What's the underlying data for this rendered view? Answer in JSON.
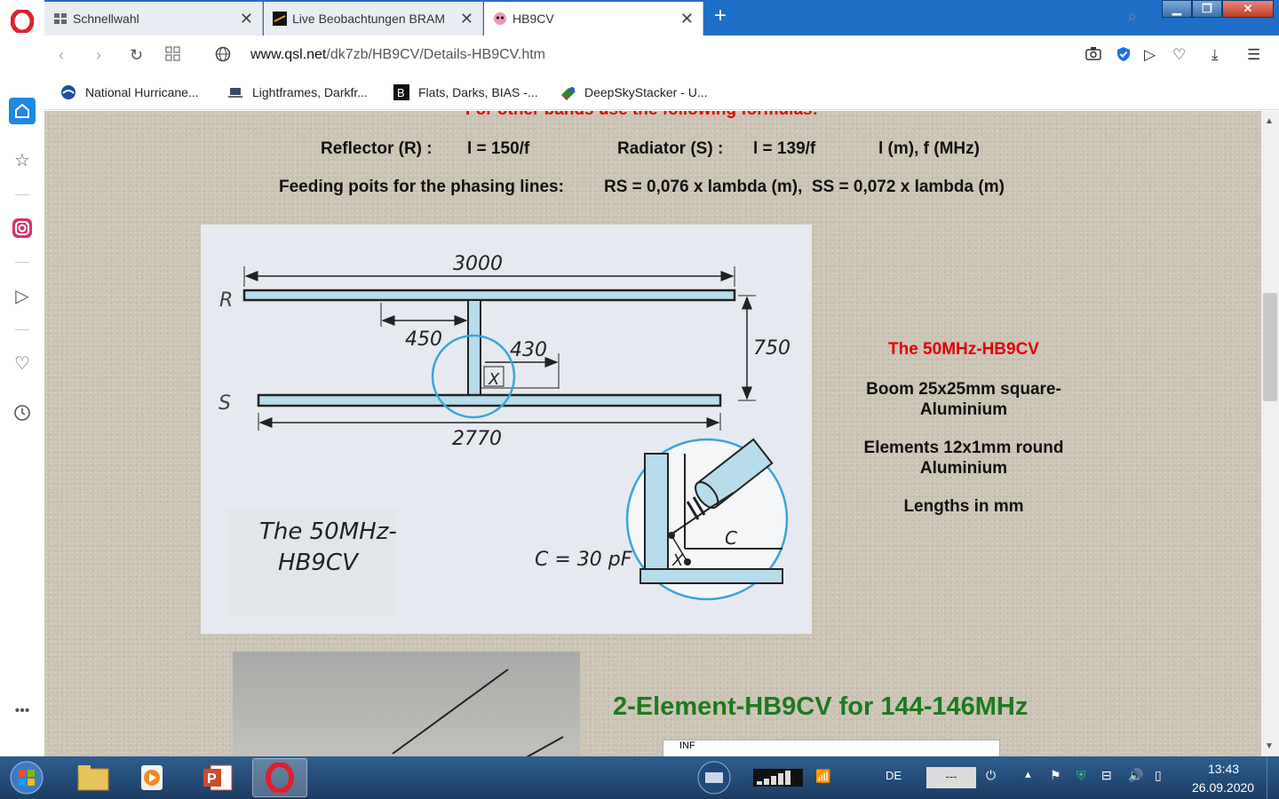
{
  "tabs": [
    {
      "label": "Schnellwahl"
    },
    {
      "label": "Live Beobachtungen BRAM"
    },
    {
      "label": "HB9CV"
    }
  ],
  "address": {
    "host": "www.qsl.net",
    "path": "/dk7zb/HB9CV/Details-HB9CV.htm"
  },
  "bookmarks": [
    {
      "label": "National Hurricane..."
    },
    {
      "label": "Lightframes, Darkfr..."
    },
    {
      "label": "Flats, Darks, BIAS -..."
    },
    {
      "label": "DeepSkyStacker - U..."
    }
  ],
  "page": {
    "formula_heading_cut": "For other bands use the following formulas:",
    "reflector_label": "Reflector (R) :",
    "reflector_formula": "l = 150/f",
    "radiator_label": "Radiator (S) :",
    "radiator_formula": "l = 139/f",
    "units": "l (m), f (MHz)",
    "feeding_label": "Feeding poits for the phasing lines:",
    "feeding_formula": "RS = 0,076 x lambda (m),  SS = 0,072 x lambda (m)",
    "diagram": {
      "reflector_letter": "R",
      "radiator_letter": "S",
      "dim_reflector": "3000",
      "dim_radiator": "2770",
      "dim_spacing": "750",
      "dim_450": "450",
      "dim_430": "430",
      "x_label": "X",
      "c_label": "C",
      "caption_line1": "The 50MHz-",
      "caption_line2": "HB9CV",
      "capacitor": "C = 30 pF"
    },
    "info_title": "The 50MHz-HB9CV",
    "info_boom": "Boom 25x25mm square-\nAluminium",
    "info_elements": "Elements 12x1mm round\nAluminium",
    "info_lengths": "Lengths in mm",
    "heading_144": "2-Element-HB9CV for 144-146MHz",
    "inf_label": "INF"
  },
  "taskbar": {
    "lang": "DE",
    "tray_box": "---",
    "time": "13:43",
    "date": "26.09.2020"
  },
  "colors": {
    "tab_strip": "#1f6fc8",
    "accent_red": "#e00000",
    "heading_green": "#1d7a1d",
    "diagram_blue": "#3aa5d8"
  }
}
